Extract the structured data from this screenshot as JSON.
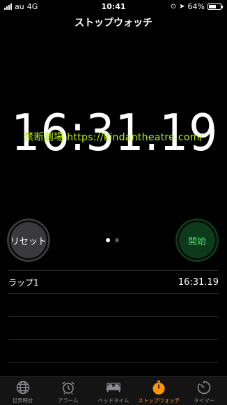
{
  "status_bar": {
    "carrier": "au",
    "network": "4G",
    "time": "10:41",
    "battery_percent": "64%",
    "battery_level": 0.64
  },
  "nav": {
    "title": "ストップウォッチ"
  },
  "stopwatch": {
    "time": "16:31.19",
    "watermark": "禁断劇場 https://kindantheatre.com/"
  },
  "buttons": {
    "reset_label": "リセット",
    "start_label": "開始"
  },
  "page_indicator": {
    "count": 2,
    "active": 0
  },
  "laps": [
    {
      "label": "ラップ1",
      "time": "16:31.19"
    },
    {
      "label": "",
      "time": ""
    },
    {
      "label": "",
      "time": ""
    },
    {
      "label": "",
      "time": ""
    },
    {
      "label": "",
      "time": ""
    }
  ],
  "tabs": [
    {
      "label": "世界時計",
      "icon": "globe-icon"
    },
    {
      "label": "アラーム",
      "icon": "alarm-clock-icon"
    },
    {
      "label": "ベッドタイム",
      "icon": "bed-icon"
    },
    {
      "label": "ストップウォッチ",
      "icon": "stopwatch-icon",
      "active": true
    },
    {
      "label": "タイマー",
      "icon": "timer-icon"
    }
  ],
  "colors": {
    "accent": "#ff9500",
    "start_green": "#4cd964",
    "watermark": "#b6f000"
  }
}
